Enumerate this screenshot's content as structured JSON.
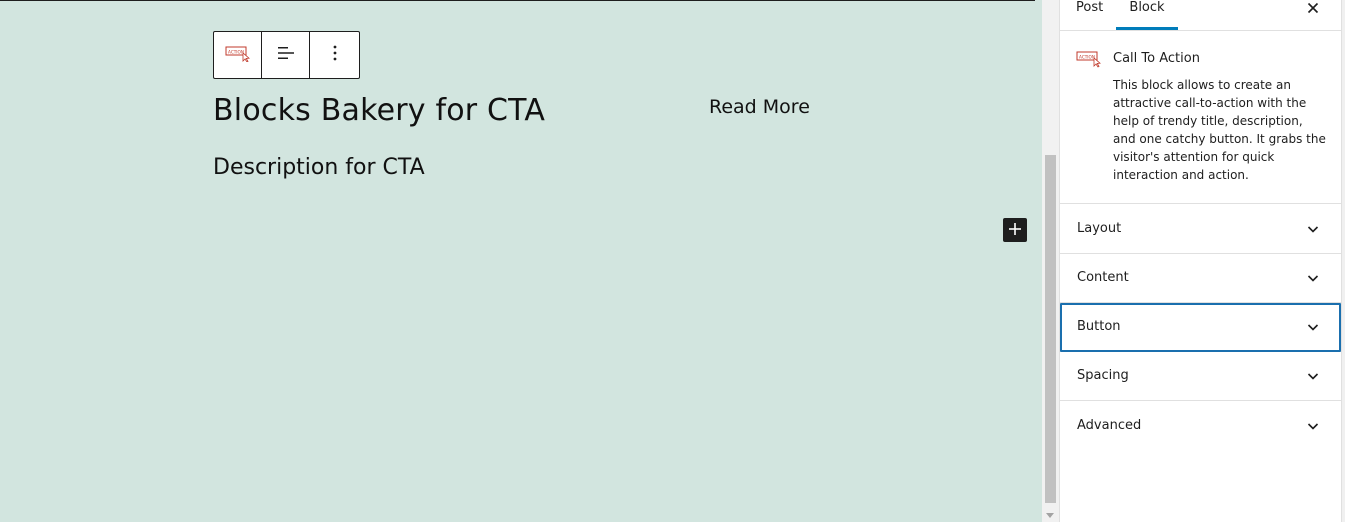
{
  "canvas": {
    "background": "#d2e5df",
    "cta": {
      "title": "Blocks Bakery for CTA",
      "description": "Description for CTA",
      "button_text": "Read More"
    },
    "toolbar": {
      "items": [
        "call-to-action-block-icon",
        "align-icon",
        "more-options-icon"
      ]
    },
    "inserter_icon": "plus-icon"
  },
  "sidebar": {
    "tabs": [
      {
        "label": "Post",
        "active": false
      },
      {
        "label": "Block",
        "active": true
      }
    ],
    "close_icon": "close-icon",
    "block_card": {
      "icon": "call-to-action-icon",
      "icon_text": "ACTION",
      "title": "Call To Action",
      "description": "This block allows to create an attractive call-to-action with the help of trendy title, description, and one catchy button. It grabs the visitor's attention for quick interaction and action."
    },
    "panels": [
      {
        "label": "Layout",
        "focused": false
      },
      {
        "label": "Content",
        "focused": false
      },
      {
        "label": "Button",
        "focused": true
      },
      {
        "label": "Spacing",
        "focused": false
      },
      {
        "label": "Advanced",
        "focused": false
      }
    ]
  },
  "colors": {
    "accent": "#007cba",
    "focus": "#1a6fae",
    "icon_red": "#c0392b"
  }
}
